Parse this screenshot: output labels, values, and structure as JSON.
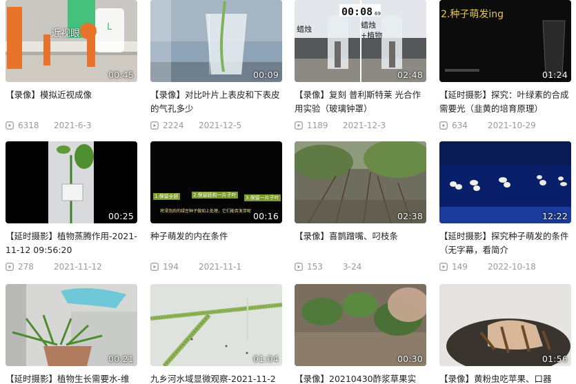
{
  "videos": [
    {
      "title": "【录像】模拟近视成像",
      "duration": "00:45",
      "views": "6318",
      "date": "2021-6-3",
      "overlay": "近视眼",
      "overlay2": "L"
    },
    {
      "title": "【录像】对比叶片上表皮和下表皮的气孔多少",
      "duration": "00:09",
      "views": "2224",
      "date": "2021-12-5"
    },
    {
      "title": "【录像】复刻 普利斯特莱 光合作用实验（玻璃钟罩）",
      "duration": "02:48",
      "views": "1189",
      "date": "2021-12-3",
      "overlay_timer": "00:08",
      "overlay_timer_small": "69",
      "overlay_left": "蜡烛",
      "overlay_right1": "蜡烛",
      "overlay_right2": "+植物"
    },
    {
      "title": "【延时摄影】探究：叶绿素的合成需要光（韭黄的培育原理）",
      "duration": "01:24",
      "views": "634",
      "date": "2021-10-29",
      "overlay": "2.种子萌发ing"
    },
    {
      "title": "【延时摄影】植物蒸腾作用-2021-11-12 09:56:20",
      "duration": "00:25",
      "views": "278",
      "date": "2021-11-12"
    },
    {
      "title": "种子萌发的内在条件",
      "duration": "00:16",
      "views": "194",
      "date": "2021-11-1",
      "overlay_a": "1.保留全胚",
      "overlay_b": "2.保留胚和一片子叶",
      "overlay_c": "3.保留一片子叶",
      "overlay_d": "将浸泡后的绿豆种子做如上处理，它们能否发芽呢"
    },
    {
      "title": "【录像】喜鹊蹭嘴、叼枝条",
      "duration": "02:38",
      "views": "153",
      "date": "3-24"
    },
    {
      "title": "【延时摄影】探究种子萌发的条件（无字幕，看简介",
      "duration": "12:22",
      "views": "149",
      "date": "2022-10-18"
    },
    {
      "title": "【延时摄影】植物生长需要水-维持",
      "duration": "00:21",
      "views": "",
      "date": ""
    },
    {
      "title": "九乡河水域显微观察-2021-11-2",
      "duration": "01:04",
      "views": "",
      "date": ""
    },
    {
      "title": "【录像】20210430酢浆草果实",
      "duration": "00:30",
      "views": "",
      "date": ""
    },
    {
      "title": "【录像】黄粉虫吃苹果、口器",
      "duration": "01:56",
      "views": "",
      "date": ""
    }
  ],
  "colors": {
    "title": "#222222",
    "meta": "#999999",
    "duration": "#ffffff"
  },
  "icons": {
    "views": "play-count-icon"
  }
}
